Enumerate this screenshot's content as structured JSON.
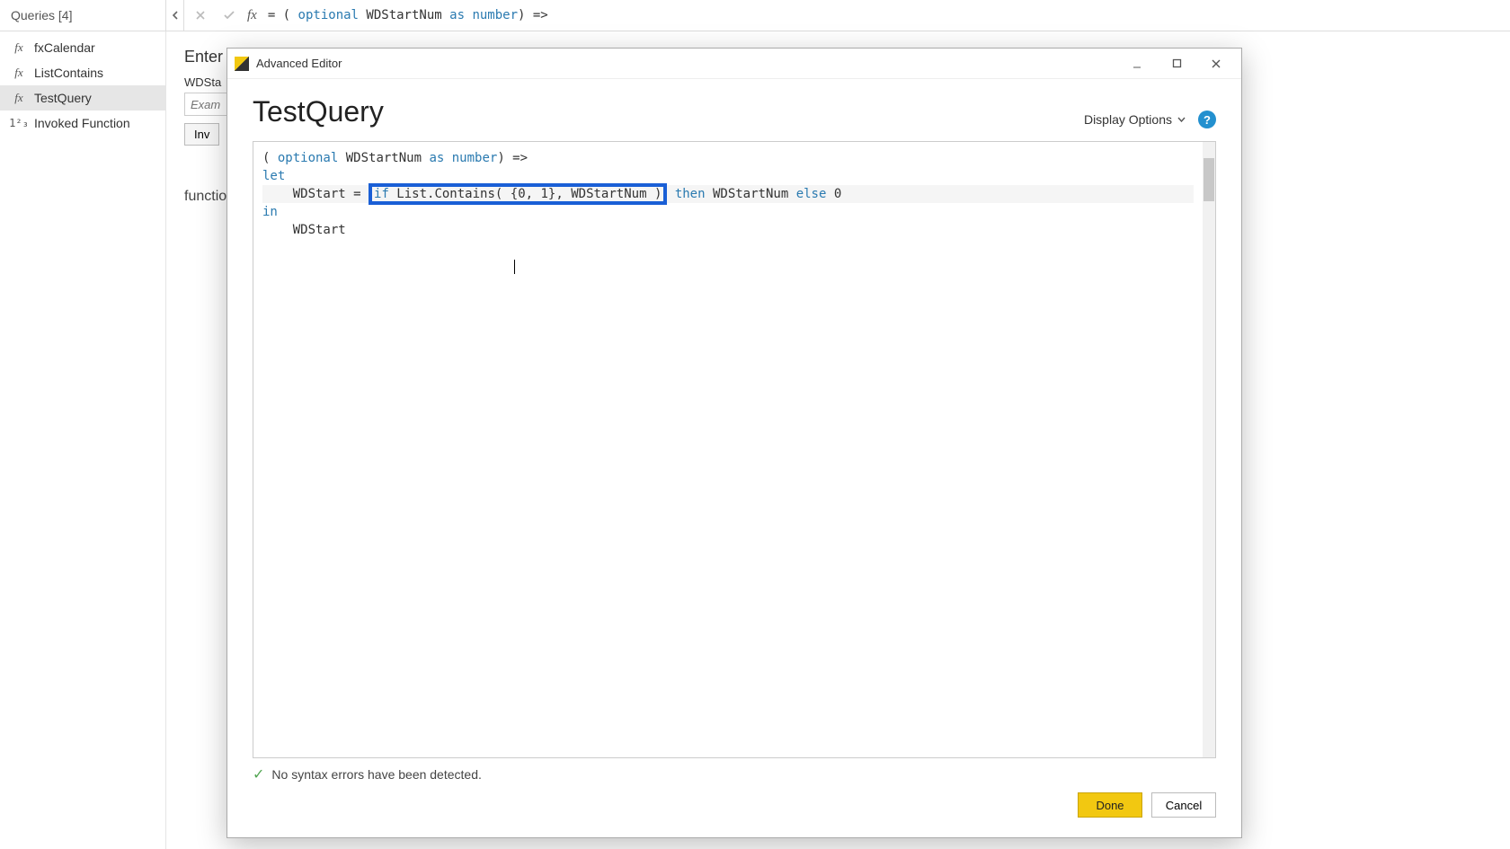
{
  "queries_panel": {
    "header": "Queries [4]",
    "items": [
      {
        "label": "fxCalendar",
        "icon": "fx"
      },
      {
        "label": "ListContains",
        "icon": "fx"
      },
      {
        "label": "TestQuery",
        "icon": "fx"
      },
      {
        "label": "Invoked Function",
        "icon": "123"
      }
    ]
  },
  "formula_bar": {
    "prefix": "= ( ",
    "kw_optional": "optional",
    "ident": " WDStartNum ",
    "kw_as": "as",
    "sp": " ",
    "kw_number": "number",
    "suffix": ") =>"
  },
  "background_form": {
    "title": "Enter ",
    "param_label": "WDSta",
    "placeholder": "Exam",
    "invoke_label": "Inv",
    "function_label": "function"
  },
  "dialog": {
    "title": "Advanced Editor",
    "query_name": "TestQuery",
    "display_options": "Display Options",
    "help": "?",
    "status": "No syntax errors have been detected.",
    "done": "Done",
    "cancel": "Cancel"
  },
  "code": {
    "l1_open": "( ",
    "l1_optional": "optional",
    "l1_ident": " WDStartNum ",
    "l1_as": "as",
    "l1_sp": " ",
    "l1_number": "number",
    "l1_end": ") =>",
    "l2_let": "let",
    "l3_indent": "    ",
    "l3_var": "WDStart = ",
    "l3_if": "if",
    "l3_fn": " List.Contains",
    "l3_paren1": "( {",
    "l3_n0": "0",
    "l3_c1": ", ",
    "l3_n1": "1",
    "l3_c2": "}, WDStartNum ",
    "l3_paren2": ")",
    "l3_sp": " ",
    "l3_then": "then",
    "l3_mid": " WDStartNum ",
    "l3_else": "else",
    "l3_sp2": " ",
    "l3_zero": "0",
    "l4_in": "in",
    "l5_indent": "    ",
    "l5_ret": "WDStart"
  }
}
